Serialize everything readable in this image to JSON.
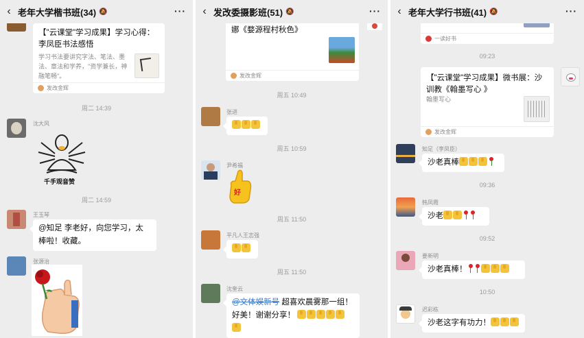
{
  "panels": [
    {
      "title": "老年大学楷书班(34)",
      "card": {
        "title": "【\"云课堂\"学习成果】学习心得：李凤臣书法感悟",
        "desc": "学习书法要讲究字法、笔法、墨法、章法和学养，\"资学兼长，神融笔畅\"。",
        "source": "发改金辉"
      },
      "time1": "周二 14:39",
      "sticker_sender": "沈大风",
      "sticker_caption": "千手观音赞",
      "time2": "周二 14:59",
      "msg_sender": "王玉琴",
      "msg_text": "@知足  李老好，向您学习，太棒啦！收藏。",
      "last_sender": "张源治"
    },
    {
      "title": "发改委摄影班(51)",
      "card_fragment": "娜《婺源程村秋色》",
      "card_source": "发改金辉",
      "time1": "周五 10:49",
      "s1": "张进",
      "time2": "周五 10:59",
      "s2": "尹希福",
      "thumb_text": "好",
      "time3": "周五 11:50",
      "s3": "平凡人王志强",
      "time4": "周五 11:50",
      "s4": "沈奎云",
      "msg_mention": "@文体娱新号",
      "msg_text": " 超喜欢晨雾那一组！好美！谢谢分享！"
    },
    {
      "title": "老年大学行书班(41)",
      "prev_source": "一读好书",
      "time1": "09:23",
      "card": {
        "title": "【\"云课堂\"学习成果】微书展：沙训教《翰墨写心 》",
        "desc": "翰墨写心",
        "source": "发改金辉"
      },
      "s1": "知足（李凤臣）",
      "m1": "沙老真棒",
      "time2": "09:36",
      "s2": "韩凤霞",
      "m2": "沙老",
      "time3": "09:52",
      "s3": "要新明",
      "m3": "沙老真棒！",
      "time4": "10:50",
      "s4": "迟彩栋",
      "m4": "沙老这字有功力！"
    }
  ],
  "icons": {
    "back": "‹",
    "more": "···",
    "mute": "bell-off-icon"
  },
  "colors": {
    "chat_bg": "#ededed",
    "bubble": "#ffffff",
    "time": "#9b9b9b",
    "nick": "#8f8f8f"
  }
}
